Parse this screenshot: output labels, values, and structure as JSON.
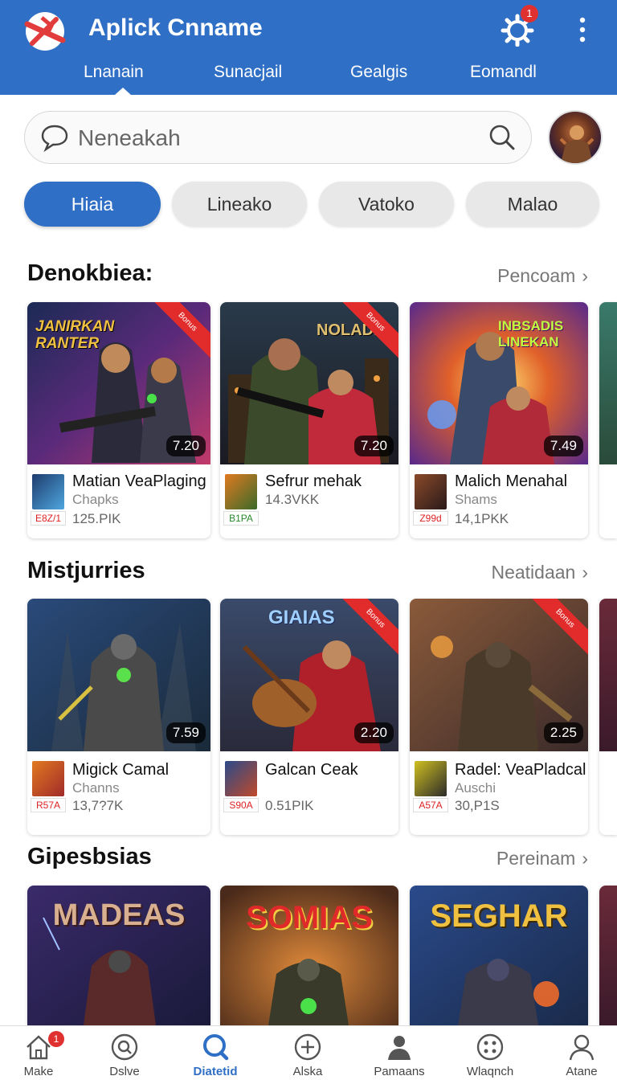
{
  "colors": {
    "primary": "#2f6fc5",
    "badge": "#e03131",
    "ribbon": "#e22b2b"
  },
  "header": {
    "title": "Aplick Cnname",
    "notification_count": "1",
    "icons": {
      "logo": "app-logo",
      "settings": "gear-icon",
      "menu": "kebab-menu-icon"
    },
    "tabs": [
      {
        "label": "Lnanain",
        "active": true
      },
      {
        "label": "Sunacjail"
      },
      {
        "label": "Gealgis"
      },
      {
        "label": "Eomandl"
      }
    ]
  },
  "search": {
    "placeholder": "Neneakah",
    "icons": {
      "left": "chat-bubble-icon",
      "right": "search-icon"
    }
  },
  "chips": [
    {
      "label": "Hiaia",
      "active": true
    },
    {
      "label": "Lineako"
    },
    {
      "label": "Vatoko"
    },
    {
      "label": "Malao"
    }
  ],
  "sections": [
    {
      "title": "Denokbiea:",
      "link": "Pencoam",
      "cards": [
        {
          "name": "Matian VeaPlaging",
          "sub": "Chapks",
          "count": "125.ΡΙΚ",
          "tag": "E8Z/1",
          "rating": "7.20",
          "ribbon": "Bonus",
          "banner": "JANIRKAN RANTER"
        },
        {
          "name": "Sefrur mehak",
          "sub": "",
          "count": "14.3VKK",
          "tag": "B1PA",
          "rating": "7.20",
          "ribbon": "Bonus",
          "banner": "NOLADI"
        },
        {
          "name": "Malich Menahal",
          "sub": "Shams",
          "count": "14,1ΡΚΚ",
          "tag": "Z99d",
          "rating": "7.49",
          "ribbon": "",
          "banner": "INBSADIS LINEKAN"
        }
      ]
    },
    {
      "title": "Mistjurries",
      "link": "Neatidaan",
      "cards": [
        {
          "name": "Migick Camal",
          "sub": "Channs",
          "count": "13,7?7K",
          "tag": "R57A",
          "rating": "7.59",
          "ribbon": "",
          "banner": ""
        },
        {
          "name": "Galcan Ceak",
          "sub": "",
          "count": "0.51ΡΙΚ",
          "tag": "S90A",
          "rating": "2.20",
          "ribbon": "Bonus",
          "banner": "GIAIAS"
        },
        {
          "name": "Radel: VeaPladcal",
          "sub": "Auschi",
          "count": "30,Ρ1S",
          "tag": "A57A",
          "rating": "2.25",
          "ribbon": "Bonus",
          "banner": ""
        }
      ]
    },
    {
      "title": "Gipesbsias",
      "link": "Pereinam",
      "cards": [
        {
          "banner": "MADEAS"
        },
        {
          "banner": "SOMIAS"
        },
        {
          "banner": "SEGHAR"
        }
      ]
    }
  ],
  "bottom_nav": [
    {
      "label": "Make",
      "icon": "home-icon",
      "badge": "1"
    },
    {
      "label": "Dslve",
      "icon": "search-circle-icon"
    },
    {
      "label": "Diatetid",
      "icon": "profile-search-icon",
      "active": true
    },
    {
      "label": "Alska",
      "icon": "plus-circle-icon"
    },
    {
      "label": "Pamaans",
      "icon": "user-icon"
    },
    {
      "label": "Wlaqnch",
      "icon": "gamepad-icon"
    },
    {
      "label": "Atane",
      "icon": "person-icon"
    }
  ]
}
